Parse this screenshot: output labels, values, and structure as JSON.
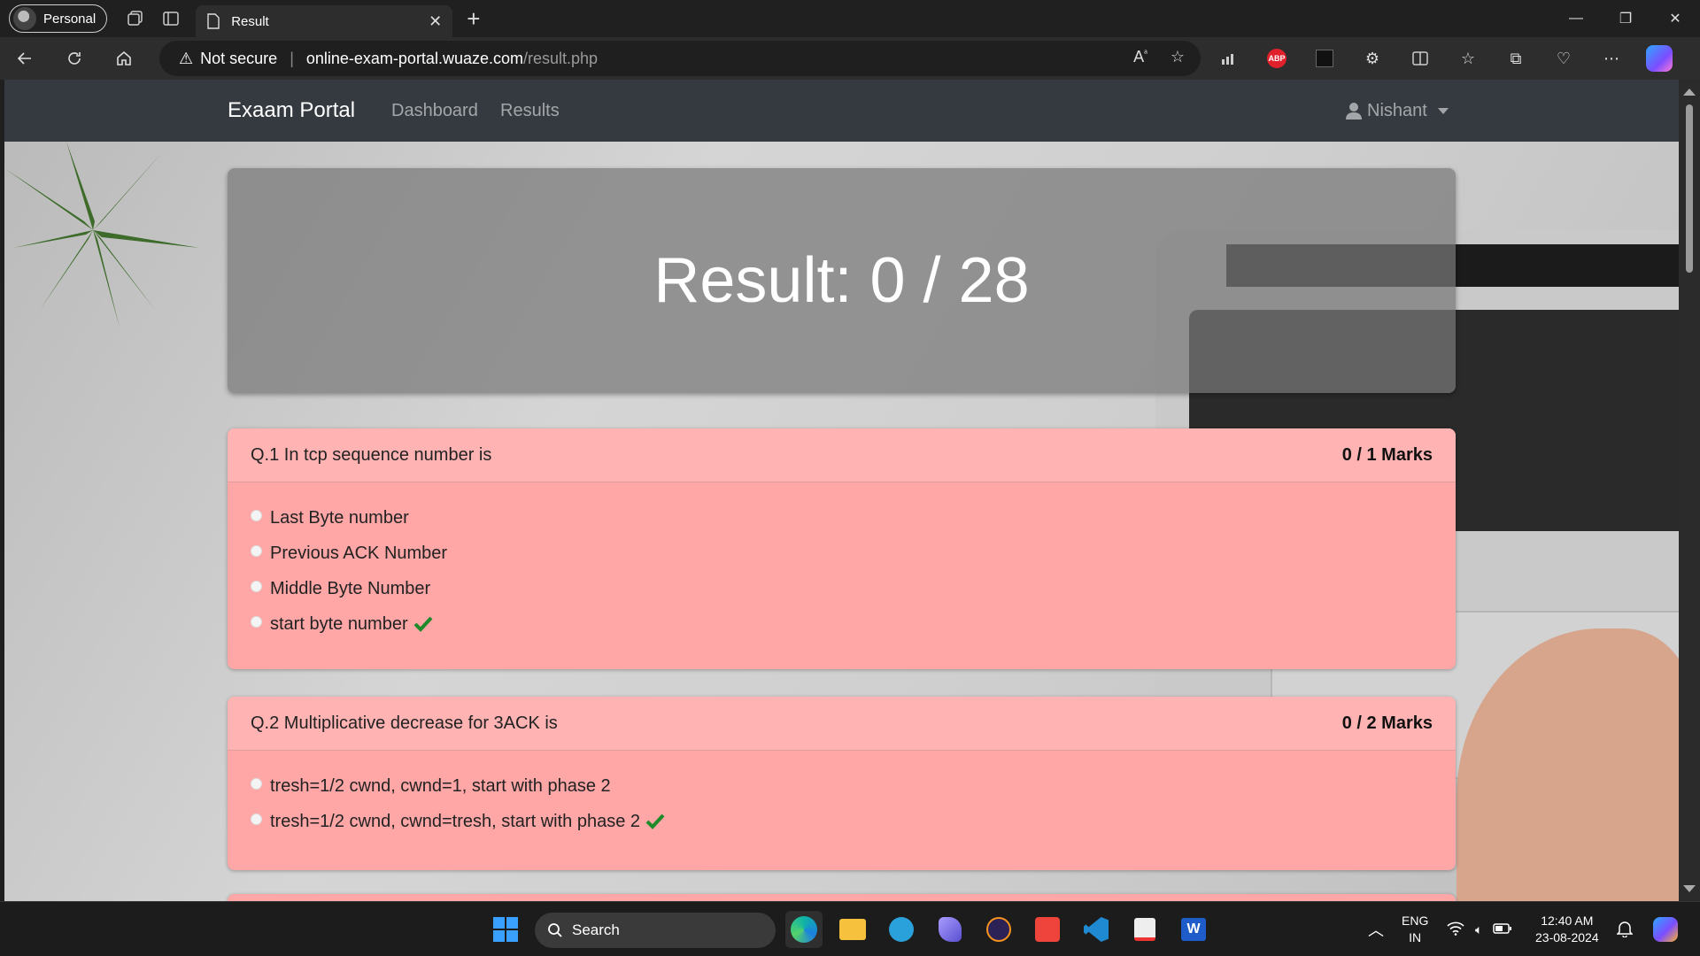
{
  "browser": {
    "profile_label": "Personal",
    "tab_title": "Result",
    "security_label": "Not secure",
    "url_host": "online-exam-portal.wuaze.com",
    "url_path": "/result.php"
  },
  "site": {
    "brand": "Exaam Portal",
    "nav_dashboard": "Dashboard",
    "nav_results": "Results",
    "user_name": "Nishant"
  },
  "result": {
    "heading": "Result: 0 / 28"
  },
  "questions": [
    {
      "title": "Q.1 In tcp sequence number is",
      "marks": "0 / 1 Marks",
      "options": [
        "Last Byte number",
        "Previous ACK Number",
        "Middle Byte Number",
        "start byte number"
      ],
      "correct_index": 3
    },
    {
      "title": "Q.2 Multiplicative decrease for 3ACK is",
      "marks": "0 / 2 Marks",
      "options": [
        "tresh=1/2 cwnd, cwnd=1, start with phase 2",
        "tresh=1/2 cwnd, cwnd=tresh, start with phase 2"
      ],
      "correct_index": 1
    }
  ],
  "taskbar": {
    "search_label": "Search",
    "lang_line1": "ENG",
    "lang_line2": "IN",
    "time": "12:40 AM",
    "date": "23-08-2024"
  },
  "colors": {
    "site_nav": "#343a40",
    "card_wrong": "#ffa6a6",
    "check": "#1e8a2a"
  }
}
